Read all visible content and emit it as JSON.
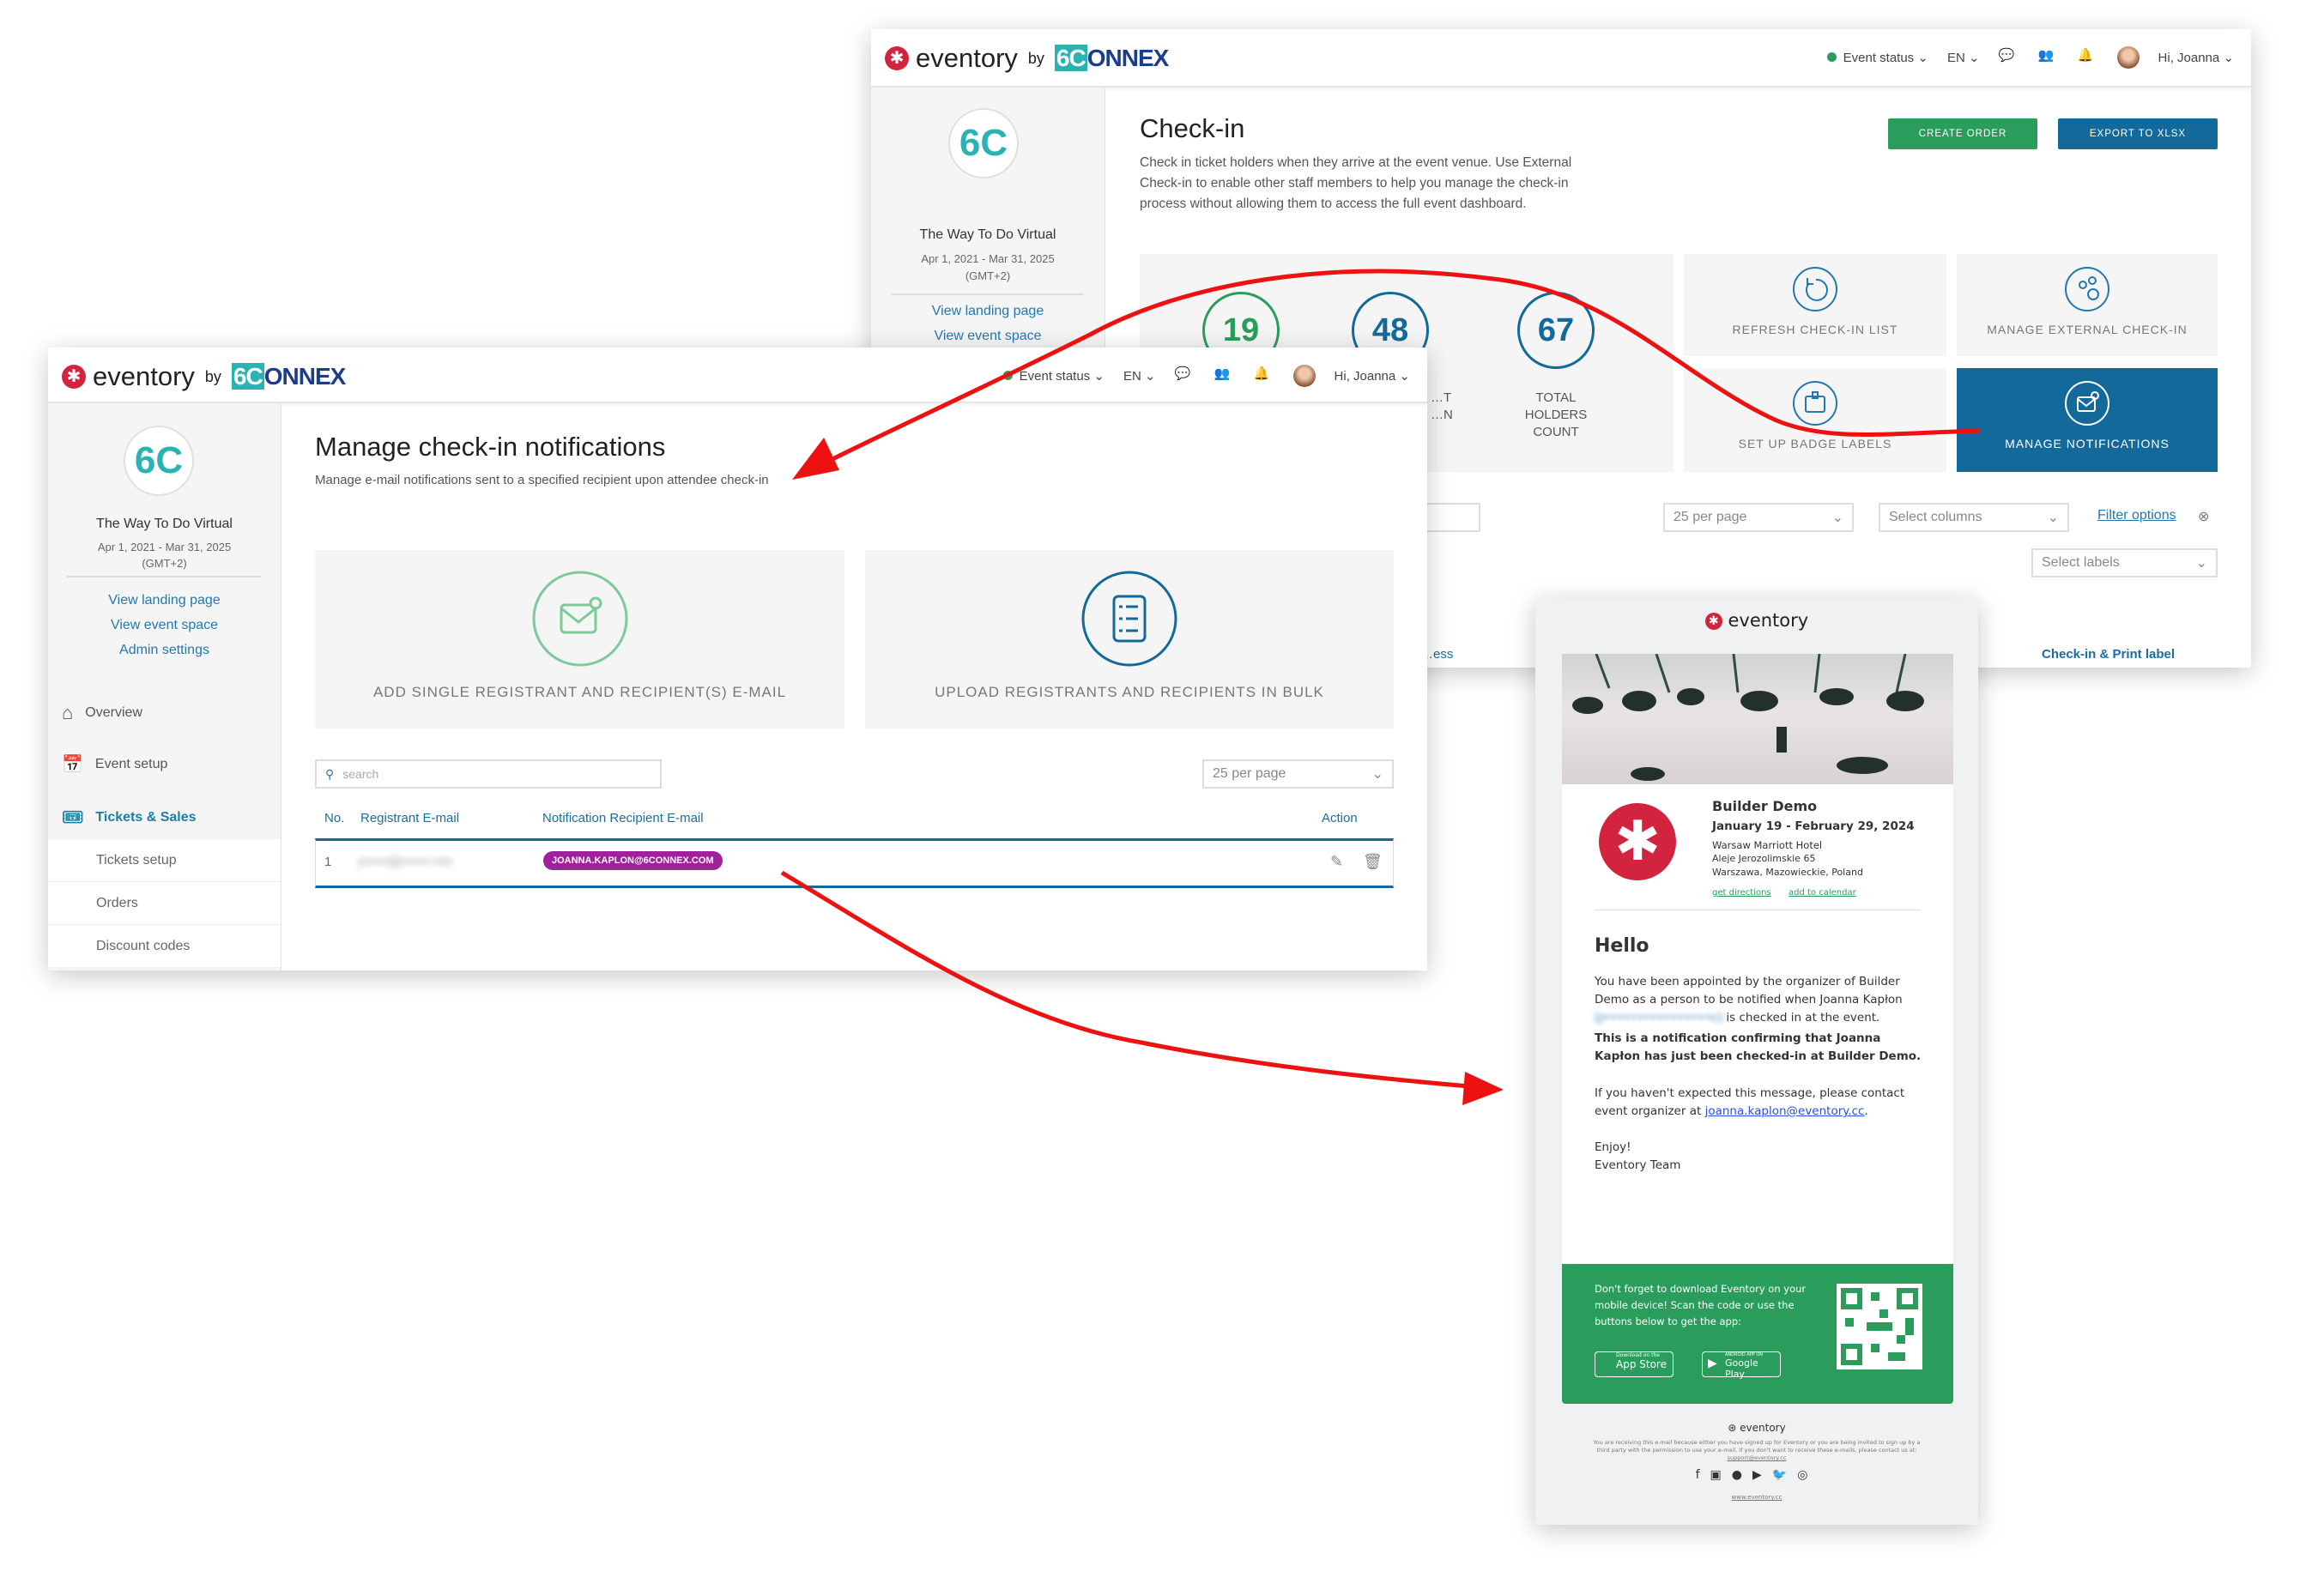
{
  "brand": {
    "name": "eventory",
    "by": "by",
    "partner": "6CONNEX"
  },
  "header": {
    "event_status": "Event status",
    "language": "EN",
    "greeting": "Hi, Joanna"
  },
  "event": {
    "name": "The Way To Do Virtual",
    "dates": "Apr 1, 2021 - Mar 31, 2025",
    "timezone": "(GMT+2)",
    "links": [
      "View landing page",
      "View event space",
      "Admin settings"
    ]
  },
  "checkin": {
    "title": "Check-in",
    "description": "Check in ticket holders when they arrive at the event venue. Use External Check-in to enable other staff members to help you manage the check-in process without allowing them to access the full event dashboard.",
    "create_order": "CREATE ORDER",
    "export": "EXPORT TO XLSX",
    "stats": [
      {
        "value": "19",
        "label": ""
      },
      {
        "value": "48",
        "label": "…T …N"
      },
      {
        "value": "67",
        "label": "TOTAL HOLDERS COUNT"
      }
    ],
    "tiles": [
      "REFRESH CHECK-IN LIST",
      "MANAGE EXTERNAL CHECK-IN",
      "SET UP BADGE LABELS",
      "MANAGE NOTIFICATIONS"
    ],
    "per_page": "25 per page",
    "select_columns": "Select columns",
    "filter_options": "Filter options",
    "select_labels": "Select labels",
    "col_partial": "…ess",
    "col_print": "Check-in & Print label"
  },
  "notifications": {
    "title": "Manage check-in notifications",
    "description": "Manage e-mail notifications sent to a specified recipient upon attendee check-in",
    "card_single": "ADD SINGLE REGISTRANT AND RECIPIENT(S) E-MAIL",
    "card_bulk": "UPLOAD REGISTRANTS AND RECIPIENTS IN BULK",
    "search_placeholder": "search",
    "per_page": "25 per page",
    "columns": [
      "No.",
      "Registrant E-mail",
      "Notification Recipient E-mail",
      "Action"
    ],
    "rows": [
      {
        "no": "1",
        "registrant": "j••••••@••••••.••m",
        "recipient": "JOANNA.KAPLON@6CONNEX.COM"
      }
    ]
  },
  "sidebar": {
    "items": [
      "Overview",
      "Event setup",
      "Tickets & Sales"
    ],
    "subitems": [
      "Tickets setup",
      "Orders",
      "Discount codes"
    ]
  },
  "email": {
    "logo": "eventory",
    "event_title": "Builder Demo",
    "event_dates": "January 19 - February 29, 2024",
    "venue": "Warsaw Marriott Hotel",
    "street": "Aleje Jerozolimskie 65",
    "city": "Warszawa, Mazowieckie, Poland",
    "get_directions": "get directions",
    "add_to_calendar": "add to calendar",
    "hello": "Hello",
    "p1": "You have been appointed by the organizer of Builder Demo as a person to be notified when Joanna Kapłon",
    "p1_email": "(j••••••••••••••••c)",
    "p1_end": "is checked in at the event.",
    "p2": "This is a notification confirming that Joanna Kapłon has just been checked-in at Builder Demo.",
    "p3": "If you haven't expected this message, please contact event organizer at",
    "p3_email": "joanna.kaplon@eventory.cc",
    "enjoy": "Enjoy!",
    "team": "Eventory Team",
    "app_promo": "Don't forget to download Eventory on your mobile device! Scan the code or use the buttons below to get the app:",
    "app_store_small": "Download on the",
    "app_store": "App Store",
    "google_small": "ANDROID APP ON",
    "google_play": "Google Play",
    "footer_logo": "eventory",
    "footer_text": "You are receiving this e-mail because either you have signed up for Eventory or you are being invited to sign up by a third party with the permission to use your e-mail. If you don't want to receive these e-mails, please contact us at:",
    "support": "support@eventory.cc",
    "website": "www.eventory.cc",
    "social": [
      "facebook",
      "linkedin",
      "spotify",
      "youtube",
      "twitter",
      "instagram"
    ]
  },
  "colors": {
    "green": "#2a9d5c",
    "blue": "#136a9a",
    "red": "#d2243f",
    "badge": "#a0219c",
    "arrow": "#ee1111"
  }
}
